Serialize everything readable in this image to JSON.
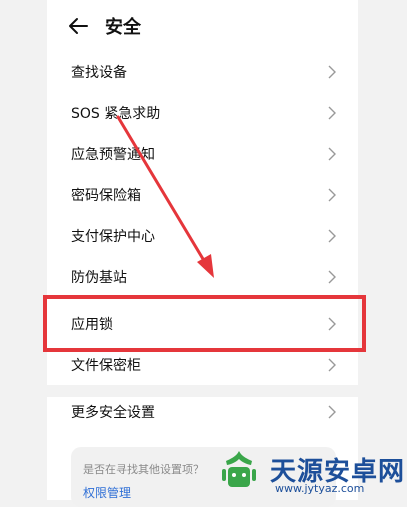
{
  "header": {
    "title": "安全"
  },
  "menu": {
    "items": [
      {
        "label": "查找设备"
      },
      {
        "label": "SOS 紧急求助"
      },
      {
        "label": "应急预警通知"
      },
      {
        "label": "密码保险箱"
      },
      {
        "label": "支付保护中心"
      },
      {
        "label": "防伪基站"
      },
      {
        "label": "应用锁"
      },
      {
        "label": "文件保密柜"
      },
      {
        "label": "更多安全设置"
      }
    ]
  },
  "suggestion": {
    "question": "是否在寻找其他设置项？",
    "link": "权限管理"
  },
  "watermark": {
    "title": "天源安卓网",
    "url": "www.jytyaz.com"
  },
  "colors": {
    "highlight": "#e5363b",
    "arrow": "#e5363b",
    "link": "#2f6fd6",
    "watermark": "#1d4f9a"
  }
}
